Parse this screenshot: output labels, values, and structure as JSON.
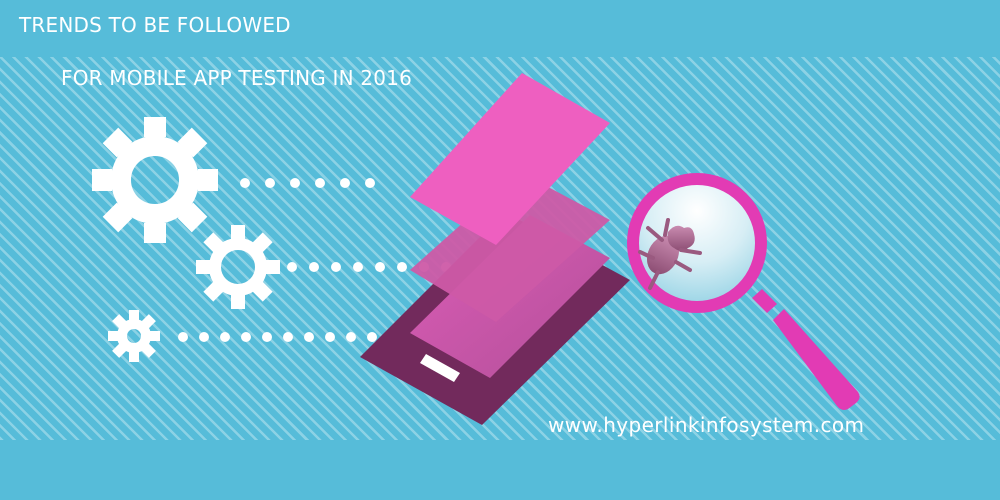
{
  "banner": {
    "title_line1": "TRENDS TO BE FOLLOWED",
    "title_line2": "FOR MOBILE APP TESTING IN 2016",
    "website": "www.hyperlinkinfosystem.com"
  },
  "icons": [
    "gear-icon-large",
    "gear-icon-medium",
    "gear-icon-small",
    "smartphone-icon",
    "app-screen-layers",
    "magnifying-glass-icon",
    "bug-icon"
  ],
  "colors": {
    "background": "#56bcd9",
    "stripe": "#ffffff",
    "phone_body": "#722a5c",
    "layer_top": "#ee5fc0",
    "layer_mid": "#cd5aa7",
    "layer_bottom": "#d45cb0",
    "magnifier": "#e23bb4",
    "bug": "#9a5a80"
  }
}
